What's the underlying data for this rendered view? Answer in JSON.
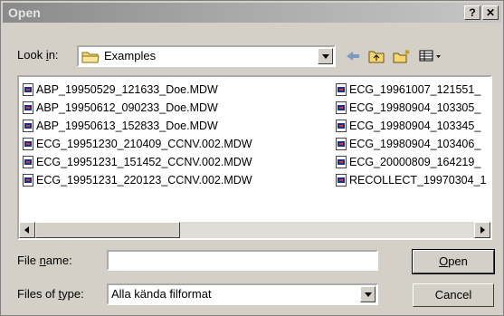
{
  "window": {
    "title": "Open",
    "help_glyph": "?",
    "close_glyph": "✕"
  },
  "lookin": {
    "label_pre": "Look ",
    "label_u": "i",
    "label_post": "n:",
    "value": "Examples"
  },
  "toolbar": {
    "back_icon": "back-arrow-icon",
    "up_icon": "up-folder-icon",
    "new_folder_icon": "new-folder-icon",
    "view_menu_icon": "view-menu-icon"
  },
  "files": {
    "column1": [
      "ABP_19950529_121633_Doe.MDW",
      "ABP_19950612_090233_Doe.MDW",
      "ABP_19950613_152833_Doe.MDW",
      "ECG_19951230_210409_CCNV.002.MDW",
      "ECG_19951231_151452_CCNV.002.MDW",
      "ECG_19951231_220123_CCNV.002.MDW"
    ],
    "column2": [
      "ECG_19961007_121551_",
      "ECG_19980904_103305_",
      "ECG_19980904_103345_",
      "ECG_19980904_103406_",
      "ECG_20000809_164219_",
      "RECOLLECT_19970304_1"
    ]
  },
  "filename": {
    "label_pre": "File ",
    "label_u": "n",
    "label_post": "ame:",
    "value": ""
  },
  "filetype": {
    "label_pre": "Files of ",
    "label_u": "t",
    "label_post": "ype:",
    "value": "Alla kända filformat"
  },
  "buttons": {
    "open_u": "O",
    "open_rest": "pen",
    "cancel": "Cancel"
  }
}
